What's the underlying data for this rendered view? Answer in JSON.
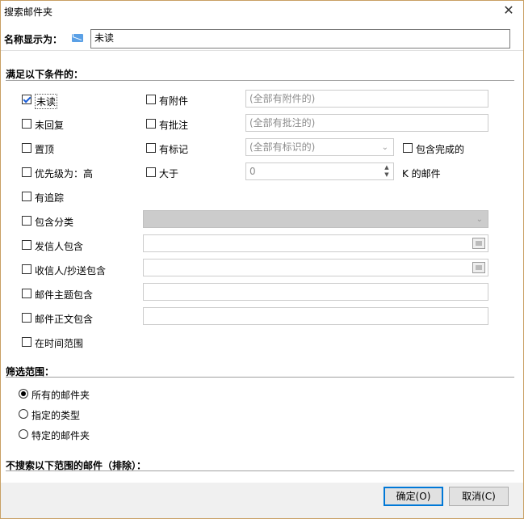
{
  "window": {
    "title": "搜索邮件夹"
  },
  "name_row": {
    "label": "名称显示为：",
    "value": "未读"
  },
  "conditions": {
    "header": "满足以下条件的：",
    "unread": {
      "label": "未读",
      "checked": true
    },
    "unreplied": {
      "label": "未回复",
      "checked": false
    },
    "pinned": {
      "label": "置顶",
      "checked": false
    },
    "priority": {
      "label": "优先级为：高",
      "checked": false
    },
    "tracked": {
      "label": "有追踪",
      "checked": false
    },
    "attachment": {
      "label": "有附件",
      "checked": false,
      "placeholder": "(全部有附件的)"
    },
    "annotation": {
      "label": "有批注",
      "checked": false,
      "placeholder": "(全部有批注的)"
    },
    "flag": {
      "label": "有标记",
      "checked": false,
      "placeholder": "(全部有标识的)"
    },
    "include_done": {
      "label": "包含完成的",
      "checked": false
    },
    "size": {
      "label": "大于",
      "checked": false,
      "value": "0",
      "unit": "K 的邮件"
    },
    "category": {
      "label": "包含分类",
      "checked": false
    },
    "sender": {
      "label": "发信人包含",
      "checked": false
    },
    "recipient": {
      "label": "收信人/抄送包含",
      "checked": false
    },
    "subject": {
      "label": "邮件主题包含",
      "checked": false
    },
    "body": {
      "label": "邮件正文包含",
      "checked": false
    },
    "time_range": {
      "label": "在时间范围",
      "checked": false
    }
  },
  "scope": {
    "header": "筛选范围：",
    "all_folders": "所有的邮件夹",
    "specified_types": "指定的类型",
    "specified_folders": "特定的邮件夹"
  },
  "exclude": {
    "header": "不搜索以下范围的邮件（排除）："
  },
  "buttons": {
    "ok": "确定(O)",
    "cancel": "取消(C)"
  },
  "colors": {
    "accent": "#0078d7",
    "frame": "#c8a064",
    "check": "#1a5ed8"
  }
}
